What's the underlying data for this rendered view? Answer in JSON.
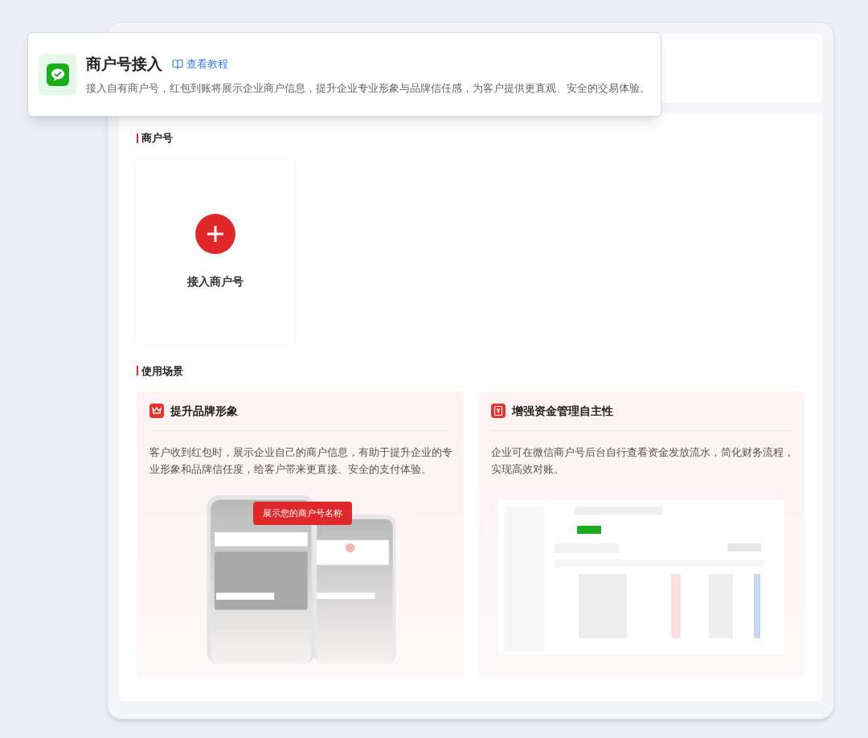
{
  "popup": {
    "title": "商户号接入",
    "tutorial_link": "查看教程",
    "description": "接入自有商户号，红包到账将展示企业商户信息，提升企业专业形象与品牌信任感，为客户提供更直观、安全的交易体验。"
  },
  "merchant_section": {
    "heading": "商户号",
    "add_card": {
      "label": "接入商户号"
    }
  },
  "scenarios_section": {
    "heading": "使用场景",
    "cards": [
      {
        "kind": "phones",
        "title": "提升品牌形象",
        "description": "客户收到红包时，展示企业自己的商户信息，有助于提升企业的专业形象和品牌信任度，给客户带来更直接、安全的支付体验。",
        "badge": "展示您的商户号名称"
      },
      {
        "kind": "dashboard",
        "title": "增强资金管理自主性",
        "description": "企业可在微信商户号后台自行查看资金发放流水，简化财务流程，实现高效对账。"
      }
    ]
  }
}
